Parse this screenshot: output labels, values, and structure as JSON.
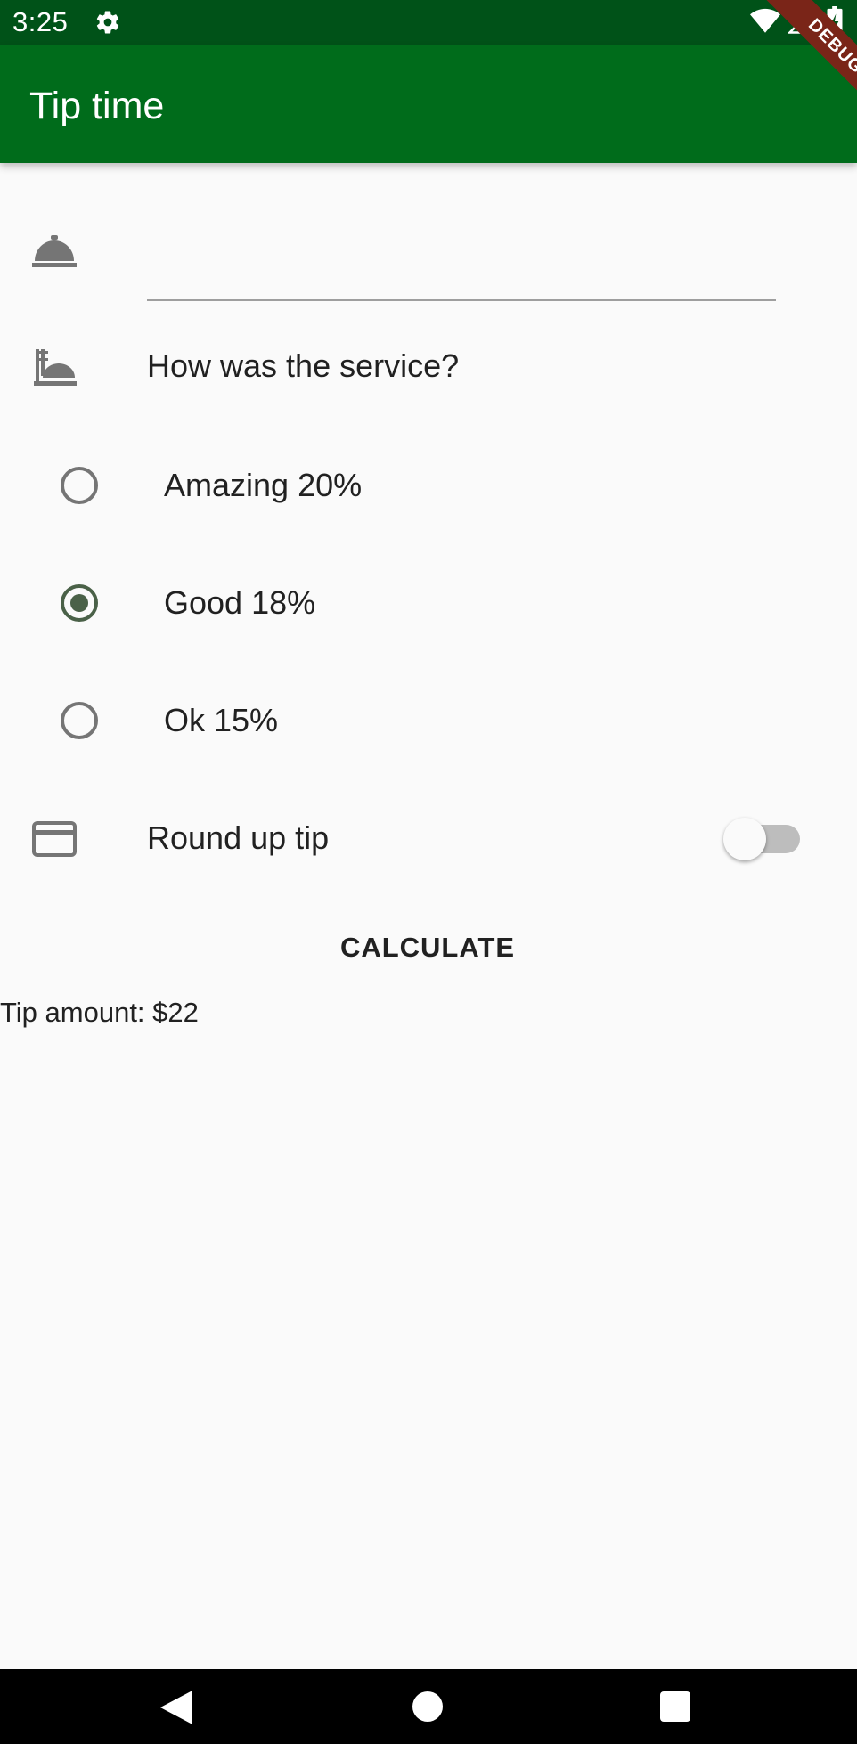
{
  "status_bar": {
    "time": "3:25",
    "icons": [
      "gear-icon",
      "wifi-icon",
      "signal-icon",
      "battery-icon"
    ]
  },
  "debug_banner": "DEBUG",
  "app_bar": {
    "title": "Tip time",
    "color": "#006c1b"
  },
  "cost_field": {
    "icon": "room-service-icon",
    "value": ""
  },
  "service": {
    "icon": "dinner-dining-icon",
    "question": "How was the service?",
    "options": [
      {
        "label": "Amazing 20%",
        "selected": false
      },
      {
        "label": "Good 18%",
        "selected": true
      },
      {
        "label": "Ok 15%",
        "selected": false
      }
    ]
  },
  "round_up": {
    "icon": "credit-card-icon",
    "label": "Round up tip",
    "on": false
  },
  "calculate_button": "CALCULATE",
  "tip_amount": "Tip amount: $22",
  "colors": {
    "status_bar": "#005218",
    "ribbon": "#7a2518",
    "radio_selected": "#4a6148"
  },
  "nav_bar": {
    "icons": [
      "back-icon",
      "home-icon",
      "recents-icon"
    ]
  }
}
